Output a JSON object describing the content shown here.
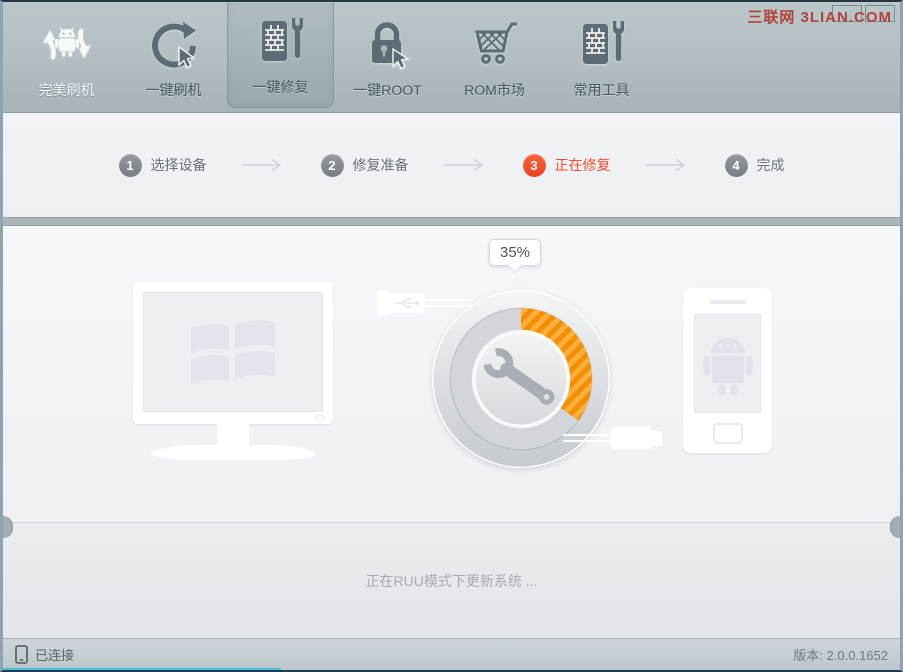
{
  "watermark": "三联网 3LIAN.COM",
  "toolbar": {
    "items": [
      {
        "label": "完美刷机"
      },
      {
        "label": "一键刷机"
      },
      {
        "label": "一键修复"
      },
      {
        "label": "一键ROOT"
      },
      {
        "label": "ROM市场"
      },
      {
        "label": "常用工具"
      }
    ],
    "active_item": "一键修复"
  },
  "steps": [
    {
      "number": "1",
      "label": "选择设备",
      "state": "pending"
    },
    {
      "number": "2",
      "label": "修复准备",
      "state": "pending"
    },
    {
      "number": "3",
      "label": "正在修复",
      "state": "active"
    },
    {
      "number": "4",
      "label": "完成",
      "state": "pending"
    }
  ],
  "progress": {
    "percent": 35,
    "percent_label": "35%"
  },
  "main": {
    "status_message": "正在RUU模式下更新系统 ..."
  },
  "statusbar": {
    "connection_status": "已连接",
    "version": "版本: 2.0.0.1652"
  },
  "colors": {
    "progress_orange": "#f28e00",
    "progress_orange_light": "#fdb03c",
    "active_step_red": "#f0502e",
    "toolbar_bg": "#b0bcc1"
  }
}
